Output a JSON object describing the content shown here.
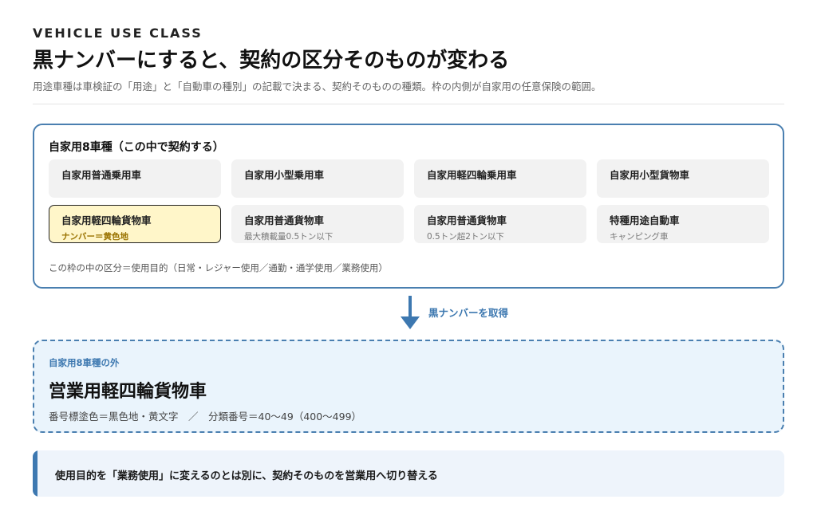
{
  "header": {
    "eyebrow": "VEHICLE USE CLASS",
    "title": "黒ナンバーにすると、契約の区分そのものが変わる",
    "subtitle": "用途車種は車検証の「用途」と「自動車の種別」の記載で決まる、契約そのものの種類。枠の内側が自家用の任意保険の範囲。"
  },
  "private_classes": {
    "title": "自家用8車種（この中で契約する）",
    "items": [
      {
        "name": "自家用普通乗用車",
        "sub": ""
      },
      {
        "name": "自家用小型乗用車",
        "sub": ""
      },
      {
        "name": "自家用軽四輪乗用車",
        "sub": ""
      },
      {
        "name": "自家用小型貨物車",
        "sub": ""
      },
      {
        "name": "自家用軽四輪貨物車",
        "sub": "ナンバー＝黄色地"
      },
      {
        "name": "自家用普通貨物車",
        "sub": "最大積載量0.5トン以下"
      },
      {
        "name": "自家用普通貨物車",
        "sub": "0.5トン超2トン以下"
      },
      {
        "name": "特種用途自動車",
        "sub": "キャンピング車"
      }
    ],
    "highlight_color": "#fff6c9",
    "note": "この枠の中の区分＝使用目的（日常・レジャー使用／通勤・通学使用／業務使用）"
  },
  "transition": {
    "label": "黒ナンバーを取得",
    "icon": "arrow-down-icon",
    "color": "#3d78b0"
  },
  "business_class": {
    "outside_label": "自家用8車種の外",
    "title": "営業用軽四輪貨物車",
    "detail": "番号標塗色＝黒色地・黄文字　／　分類番号＝40〜49（400〜499）"
  },
  "callout": {
    "text": "使用目的を「業務使用」に変えるのとは別に、契約そのものを営業用へ切り替える"
  }
}
